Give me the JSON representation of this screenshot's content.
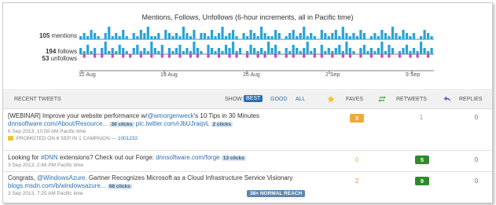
{
  "chart": {
    "title": "Mentions, Follows, Unfollows (6-hour increments, all in Pacific time)",
    "mentions_count": "105",
    "mentions_label": "mentions",
    "follows_count": "194",
    "follows_label": "follows",
    "unfollows_count": "53",
    "unfollows_label": "unfollows",
    "colors": {
      "mentions": "#27a3dd",
      "follows": "#27a3dd",
      "unfollows": "#d641c8",
      "baseline": "#555555"
    },
    "x_ticks": [
      "12 Aug",
      "19 Aug",
      "26 Aug",
      "2 Sep",
      "9 Sep"
    ]
  },
  "chart_data": {
    "type": "bar",
    "title": "Mentions, Follows, Unfollows (6-hour increments, all in Pacific time)",
    "x_tick_labels": [
      "12 Aug",
      "19 Aug",
      "26 Aug",
      "2 Sep",
      "9 Sep"
    ],
    "series": [
      {
        "name": "mentions",
        "values": [
          1,
          2,
          1,
          3,
          2,
          1,
          0,
          2,
          4,
          1,
          2,
          1,
          3,
          1,
          0,
          2,
          1,
          3,
          2,
          4,
          1,
          1,
          2,
          0,
          3,
          2,
          1,
          2,
          1,
          4,
          2,
          1,
          3,
          0,
          2,
          2,
          1,
          3,
          1,
          2,
          4,
          1,
          2,
          3,
          1,
          0,
          2,
          1,
          3,
          2,
          1,
          4,
          2,
          1,
          1,
          3,
          2,
          0,
          1,
          2,
          3,
          1,
          2,
          4,
          1,
          2,
          1,
          0,
          3,
          2,
          1,
          2,
          3,
          1,
          4,
          2,
          1,
          2,
          1,
          3,
          2,
          0,
          1,
          2,
          1,
          3,
          2,
          1,
          4,
          2,
          1,
          3,
          2,
          1,
          2,
          0,
          1,
          3,
          2,
          1
        ]
      },
      {
        "name": "follows",
        "values": [
          2,
          1,
          3,
          1,
          2,
          0,
          2,
          4,
          1,
          2,
          1,
          3,
          2,
          1,
          0,
          2,
          3,
          1,
          2,
          1,
          4,
          2,
          1,
          3,
          0,
          2,
          1,
          2,
          3,
          1,
          2,
          1,
          4,
          2,
          1,
          0,
          3,
          2,
          1,
          2,
          1,
          3,
          2,
          4,
          1,
          2,
          0,
          1,
          3,
          2,
          1,
          2,
          1,
          4,
          2,
          3,
          1,
          0,
          2,
          1,
          3,
          2,
          1,
          2,
          4,
          1,
          2,
          0,
          3,
          1,
          2,
          1,
          2,
          3,
          1,
          4,
          2,
          1,
          0,
          2,
          3,
          1,
          2,
          1,
          2,
          4,
          1,
          3,
          2,
          0,
          1,
          2,
          3,
          1,
          2,
          1,
          4,
          2,
          1,
          2
        ]
      },
      {
        "name": "unfollows",
        "values": [
          0,
          1,
          0,
          0,
          1,
          0,
          1,
          0,
          0,
          1,
          0,
          0,
          1,
          0,
          1,
          0,
          0,
          1,
          0,
          0,
          1,
          0,
          0,
          1,
          0,
          1,
          0,
          0,
          1,
          0,
          0,
          1,
          0,
          1,
          0,
          0,
          1,
          0,
          0,
          1,
          0,
          0,
          1,
          0,
          1,
          0,
          0,
          1,
          0,
          0,
          1,
          0,
          1,
          0,
          0,
          1,
          0,
          0,
          1,
          0,
          1,
          0,
          0,
          1,
          0,
          0,
          1,
          0,
          1,
          0,
          0,
          1,
          0,
          0,
          1,
          0,
          1,
          0,
          0,
          1,
          0,
          0,
          1,
          0,
          0,
          1,
          0,
          1,
          0,
          0,
          1,
          0,
          0,
          1,
          0,
          1,
          0,
          0,
          1,
          0
        ]
      }
    ]
  },
  "tweets_header": {
    "recent": "RECENT TWEETS",
    "show": "SHOW:",
    "best": "BEST",
    "good": "GOOD",
    "all": "ALL",
    "faves": "FAVES",
    "retweets": "RETWEETS",
    "replies": "REPLIES"
  },
  "tweets": [
    {
      "line1_pre": "[WEBINAR] Improve your website performance w/",
      "mention": "@wmorgenweck",
      "line1_post": "'s 10 Tips in 30 Minutes",
      "link1": "dnnsoftware.com/About/Resource...",
      "clicks1": "30 clicks",
      "link2": "pic.twitter.com/rJbUJraqvL",
      "clicks2": "2 clicks",
      "meta": "6 Sep 2013, 10:59 AM Pacific time",
      "promoted": "PROMOTED ON 6 SEP IN 1 CAMPAIGN —",
      "campaign": "1001232",
      "faves": "3",
      "retweets": "1",
      "replies": "0"
    },
    {
      "pre": "Looking for ",
      "hashtag": "#DNN",
      "mid": " extensions? Check out our Forge: ",
      "link1": "dnnsoftware.com/forge",
      "clicks1": "13 clicks",
      "meta": "3 Sep 2013, 2:48 PM Pacific time",
      "faves": "0",
      "retweets": "5",
      "replies": "0"
    },
    {
      "pre": "Congrats, ",
      "mention": "@WindowsAzure",
      "post": ". Gartner Recognizes Microsoft as a Cloud Infrastructure Service Visionary",
      "link1": "blogs.msdn.com/b/windowsazure...",
      "clicks1": "68 clicks",
      "meta": "3 Sep 2013, 7:25 AM Pacific time",
      "reach": "38× NORMAL REACH",
      "faves": "2",
      "retweets": "9",
      "replies": "0"
    }
  ]
}
